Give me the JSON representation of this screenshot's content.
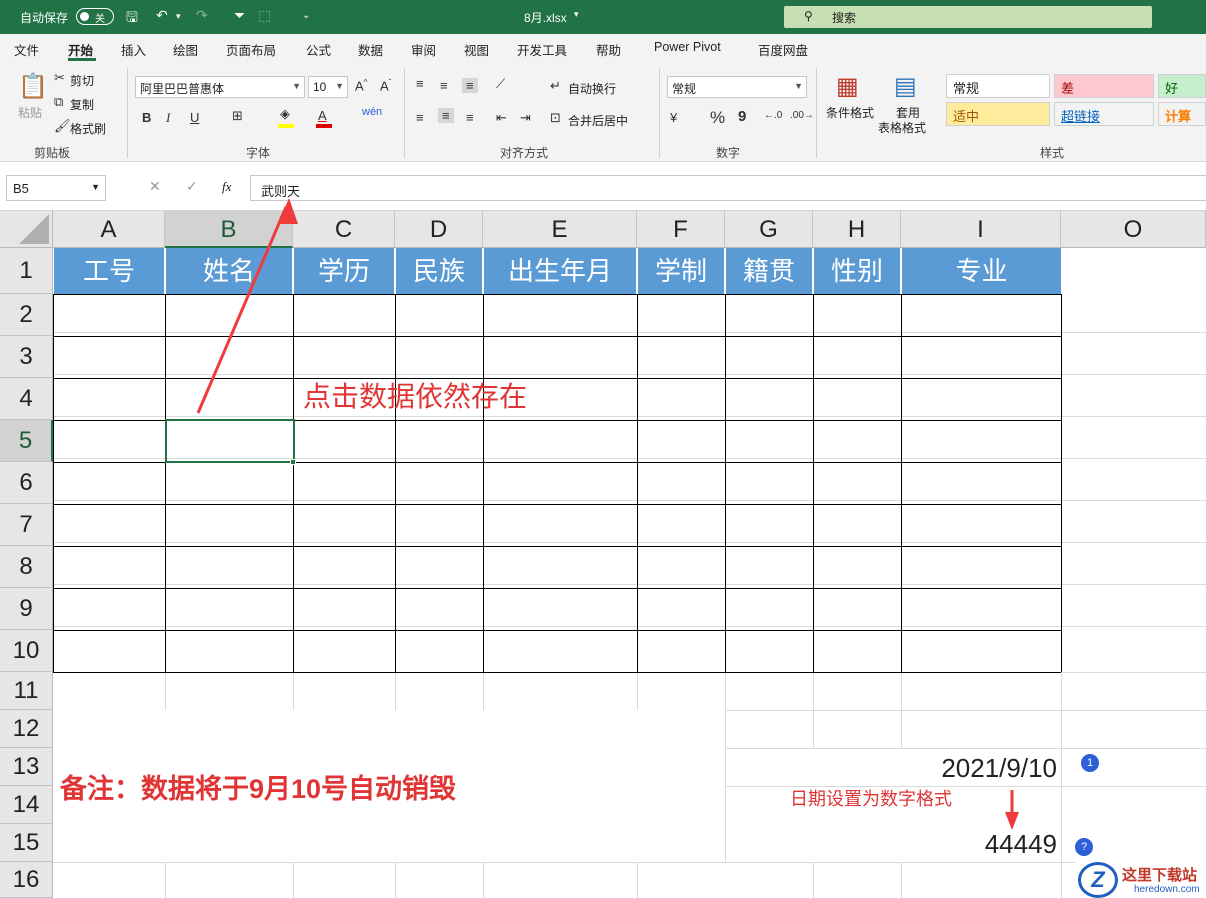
{
  "titlebar": {
    "autosave_label": "自动保存",
    "autosave_state": "关",
    "filename": "8月.xlsx",
    "search_placeholder": "搜索"
  },
  "tabs": [
    "文件",
    "开始",
    "插入",
    "绘图",
    "页面布局",
    "公式",
    "数据",
    "审阅",
    "视图",
    "开发工具",
    "帮助",
    "Power Pivot",
    "百度网盘"
  ],
  "ribbon": {
    "clipboard": {
      "paste": "粘贴",
      "cut": "剪切",
      "copy": "复制",
      "format_painter": "格式刷",
      "group": "剪贴板"
    },
    "font": {
      "name": "阿里巴巴普惠体",
      "size": "10",
      "group": "字体",
      "bold": "B",
      "italic": "I",
      "underline": "U"
    },
    "alignment": {
      "wrap": "自动换行",
      "merge": "合并后居中",
      "group": "对齐方式"
    },
    "number": {
      "format": "常规",
      "percent": "%",
      "comma": "9",
      "group": "数字"
    },
    "styles": {
      "conditional": "条件格式",
      "table_format_1": "套用",
      "table_format_2": "表格格式",
      "group": "样式",
      "cells": [
        {
          "label": "常规",
          "bg": "#ffffff",
          "color": "#222222"
        },
        {
          "label": "差",
          "bg": "#ffc7ce",
          "color": "#9c0006"
        },
        {
          "label": "好",
          "bg": "#c6efce",
          "color": "#006100"
        },
        {
          "label": "适中",
          "bg": "#ffeb9c",
          "color": "#9c5700"
        },
        {
          "label": "超链接",
          "bg": "#f3f3f3",
          "color": "#0563c1"
        },
        {
          "label": "计算",
          "bg": "#f2f2f2",
          "color": "#fa7d00"
        }
      ]
    }
  },
  "formula_bar": {
    "name_box": "B5",
    "cancel": "✕",
    "enter": "✓",
    "fx": "fx",
    "content": "武则天"
  },
  "columns": [
    "A",
    "B",
    "C",
    "D",
    "E",
    "F",
    "G",
    "H",
    "I",
    "O"
  ],
  "rows": [
    "1",
    "2",
    "3",
    "4",
    "5",
    "6",
    "7",
    "8",
    "9",
    "10",
    "11",
    "12",
    "13",
    "14",
    "15",
    "16"
  ],
  "selected_cell": "B5",
  "table_headers": [
    "工号",
    "姓名",
    "学历",
    "民族",
    "出生年月",
    "学制",
    "籍贯",
    "性别",
    "专业"
  ],
  "annotations": {
    "click_note": "点击数据依然存在",
    "remark": "备注：数据将于9月10号自动销毁",
    "date_value": "2021/9/10",
    "date_note": "日期设置为数字格式",
    "serial_value": "44449",
    "badge_1": "1",
    "badge_2": "?"
  },
  "watermark": {
    "brand": "这里下载站",
    "url": "heredown.com"
  },
  "colors": {
    "title_green": "#217346",
    "header_blue": "#5b9bd5",
    "annotation_red": "#e03535"
  }
}
